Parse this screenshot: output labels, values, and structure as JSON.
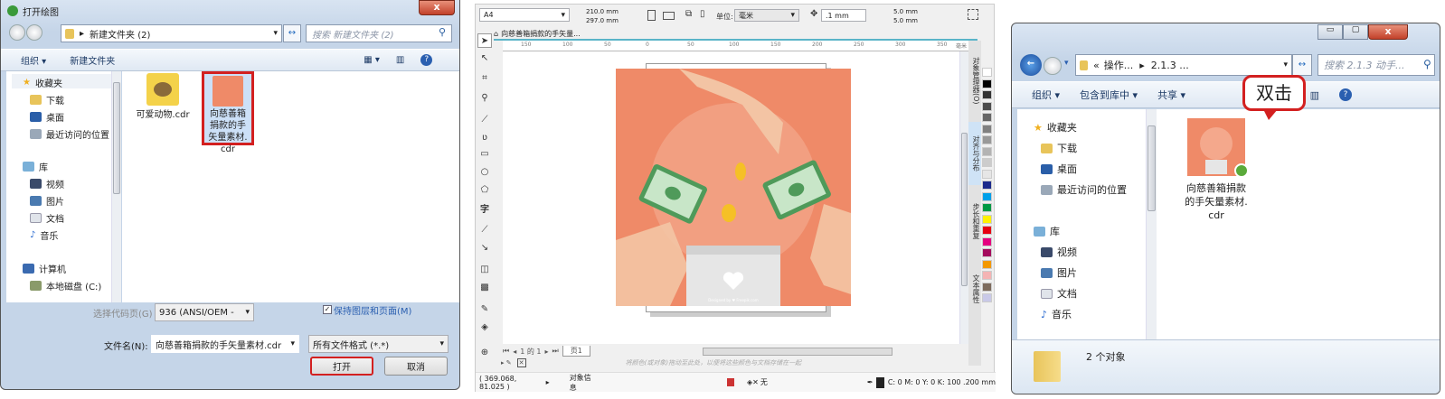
{
  "open_dialog": {
    "title": "打开绘图",
    "address": "新建文件夹 (2)",
    "search_placeholder": "搜索 新建文件夹 (2)",
    "toolbar": {
      "organize": "组织 ▾",
      "new_folder": "新建文件夹"
    },
    "nav": [
      {
        "label": "收藏夹",
        "icon": "star-icon"
      },
      {
        "label": "下载",
        "icon": "download-folder-icon"
      },
      {
        "label": "桌面",
        "icon": "desktop-icon"
      },
      {
        "label": "最近访问的位置",
        "icon": "recent-places-icon"
      },
      {
        "label": "库",
        "icon": "library-icon"
      },
      {
        "label": "视频",
        "icon": "video-icon"
      },
      {
        "label": "图片",
        "icon": "pictures-icon"
      },
      {
        "label": "文档",
        "icon": "documents-icon"
      },
      {
        "label": "音乐",
        "icon": "music-icon"
      },
      {
        "label": "计算机",
        "icon": "computer-icon"
      },
      {
        "label": "本地磁盘 (C:)",
        "icon": "disk-icon"
      }
    ],
    "files": [
      {
        "name": "可爱动物.cdr"
      },
      {
        "name": "向慈善箱捐款的手矢量素材.cdr",
        "selected": true
      }
    ],
    "codepage_label": "选择代码页(G)",
    "codepage_value": "936   (ANSI/OEM -",
    "keep_layers_label": "保持图层和页面(M)",
    "keep_layers_checked": true,
    "filename_label": "文件名(N):",
    "filename_value": "向慈善箱捐款的手矢量素材.cdr",
    "filetype_value": "所有文件格式 (*.*)",
    "open_button": "打开",
    "cancel_button": "取消",
    "close": "x"
  },
  "corel": {
    "page_size": "A4",
    "width": "210.0 mm",
    "height": "297.0 mm",
    "units_label": "单位:",
    "units_value": "毫米",
    "nudge": ".1 mm",
    "dup_x": "5.0 mm",
    "dup_y": "5.0 mm",
    "doc_tab": "向慈善箱捐款的手矢量...",
    "ruler_ticks": [
      "150",
      "100",
      "50",
      "0",
      "50",
      "100",
      "150",
      "200",
      "250",
      "300",
      "350"
    ],
    "ruler_unit": "毫米",
    "dockers": [
      "对象管理器(O)",
      "对齐与分布",
      "步长和重复",
      "文本属性"
    ],
    "page_nav": "1 的 1",
    "page_tab": "页1",
    "color_hint": "将颜色(或对象)拖动至此处，以便将这些颜色与文档存储在一起",
    "coords": "( 369.068, 81.025 )",
    "object_info": "对象信息",
    "fill_none": "无",
    "outline_info": "C: 0 M: 0 Y: 0 K: 100  .200 mm",
    "artwork_credit": "Designed by ♥ Freepik.com",
    "palette": [
      "#ffffff",
      "#000000",
      "#333333",
      "#4d4d4d",
      "#666666",
      "#808080",
      "#999999",
      "#b3b3b3",
      "#cccccc",
      "#e6e6e6",
      "#1b2a8c",
      "#00a0e9",
      "#009944",
      "#fff100",
      "#e60012",
      "#e4007f",
      "#a40b5d",
      "#f39800",
      "#f4b4b4",
      "#7d6b5d",
      "#c9c9e8"
    ]
  },
  "explorer": {
    "address_parts": [
      "«",
      "操作...",
      "▸",
      "2.1.3 ..."
    ],
    "search_placeholder": "搜索 2.1.3 动手...",
    "toolbar": {
      "organize": "组织 ▾",
      "include": "包含到库中 ▾",
      "share": "共享 ▾"
    },
    "callout": "双击",
    "nav": [
      {
        "label": "收藏夹"
      },
      {
        "label": "下载"
      },
      {
        "label": "桌面"
      },
      {
        "label": "最近访问的位置"
      },
      {
        "label": "库"
      },
      {
        "label": "视频"
      },
      {
        "label": "图片"
      },
      {
        "label": "文档"
      },
      {
        "label": "音乐"
      }
    ],
    "file": "向慈善箱捐款的手矢量素材.cdr",
    "status": "2 个对象",
    "close": "x"
  }
}
